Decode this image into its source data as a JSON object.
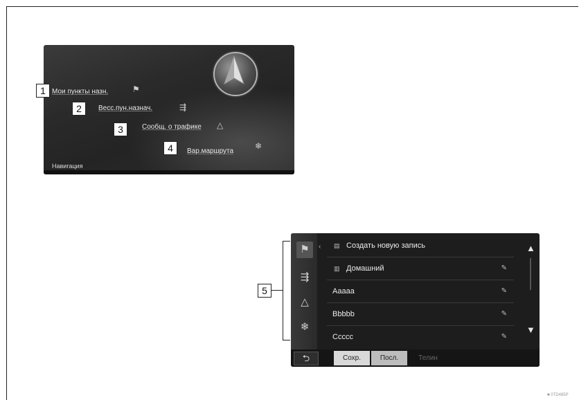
{
  "screen1": {
    "menu": [
      {
        "number": "1",
        "label": "Мои пункты назн.",
        "icon": "flag-icon"
      },
      {
        "number": "2",
        "label": "Весс.пун.назнач.",
        "icon": "signpost-icon"
      },
      {
        "number": "3",
        "label": "Сообщ. о трафике",
        "icon": "traffic-icon"
      },
      {
        "number": "4",
        "label": "Вар.маршрута",
        "icon": "route-options-icon"
      }
    ],
    "footer_label": "Навигация"
  },
  "screen2": {
    "callout_number": "5",
    "rows": [
      {
        "label": "Создать новую запись",
        "icon": "new-entry-icon",
        "editable": false
      },
      {
        "label": "Домашний",
        "icon": "home-icon",
        "editable": true
      },
      {
        "label": "Aaaaa",
        "editable": true
      },
      {
        "label": "Bbbbb",
        "editable": true
      },
      {
        "label": "Ccccc",
        "editable": true
      }
    ],
    "tabs": [
      "Сохр.",
      "Посл.",
      "Телин"
    ],
    "back_symbol": "⮌"
  },
  "figure_code": "■ 0TD485P",
  "colors": {
    "screen_bg": "#242424",
    "text": "#e8e8e8"
  }
}
